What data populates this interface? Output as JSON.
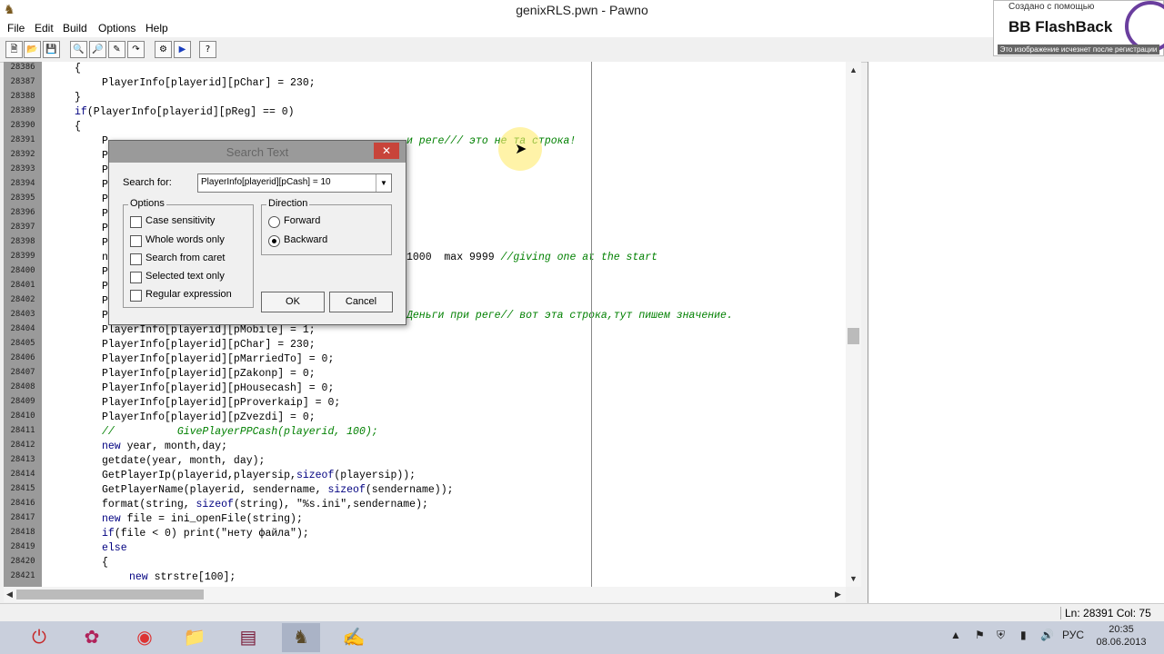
{
  "window": {
    "title": "genixRLS.pwn - Pawno"
  },
  "menu": [
    "File",
    "Edit",
    "Build",
    "Options",
    "Help"
  ],
  "badge": {
    "top": "Создано с помощью",
    "brand": "BB FlashBack",
    "strip": "Это изображение исчезнет после регистрации"
  },
  "line_numbers": [
    "28386",
    "28387",
    "28388",
    "28389",
    "28390",
    "28391",
    "28392",
    "28393",
    "28394",
    "28395",
    "28396",
    "28397",
    "28398",
    "28399",
    "28400",
    "28401",
    "28402",
    "28403",
    "28404",
    "28405",
    "28406",
    "28407",
    "28408",
    "28409",
    "28410",
    "28411",
    "28412",
    "28413",
    "28414",
    "28415",
    "28416",
    "28417",
    "28418",
    "28419",
    "28420",
    "28421"
  ],
  "code_lines": [
    {
      "indent": 1,
      "text": "{"
    },
    {
      "indent": 2,
      "text": "PlayerInfo[playerid][pChar] = 230;"
    },
    {
      "indent": 1,
      "text": "}"
    },
    {
      "indent": 1,
      "text": "if(PlayerInfo[playerid][pReg] == 0)"
    },
    {
      "indent": 1,
      "text": "{"
    },
    {
      "indent": 2,
      "text": "P"
    },
    {
      "indent": 2,
      "text": "P"
    },
    {
      "indent": 2,
      "text": "P"
    },
    {
      "indent": 2,
      "text": "P"
    },
    {
      "indent": 2,
      "text": "P"
    },
    {
      "indent": 2,
      "text": "P"
    },
    {
      "indent": 2,
      "text": "P"
    },
    {
      "indent": 2,
      "text": "P"
    },
    {
      "indent": 2,
      "text": "n"
    },
    {
      "indent": 2,
      "text": "P"
    },
    {
      "indent": 2,
      "text": "P"
    },
    {
      "indent": 2,
      "text": "P"
    },
    {
      "indent": 2,
      "text": "P"
    },
    {
      "indent": 2,
      "text": "PlayerInfo[playerid][pMobile] = 1;"
    },
    {
      "indent": 2,
      "text": "PlayerInfo[playerid][pChar] = 230;"
    },
    {
      "indent": 2,
      "text": "PlayerInfo[playerid][pMarriedTo] = 0;"
    },
    {
      "indent": 2,
      "text": "PlayerInfo[playerid][pZakonp] = 0;"
    },
    {
      "indent": 2,
      "text": "PlayerInfo[playerid][pHousecash] = 0;"
    },
    {
      "indent": 2,
      "text": "PlayerInfo[playerid][pProverkaip] = 0;"
    },
    {
      "indent": 2,
      "text": "PlayerInfo[playerid][pZvezdi] = 0;"
    },
    {
      "indent": 2,
      "text": "//          GivePlayerPPCash(playerid, 100);",
      "comment": true
    },
    {
      "indent": 2,
      "text": "new year, month,day;"
    },
    {
      "indent": 2,
      "text": "getdate(year, month, day);"
    },
    {
      "indent": 2,
      "text": "GetPlayerIp(playerid,playersip,sizeof(playersip));"
    },
    {
      "indent": 2,
      "text": "GetPlayerName(playerid, sendername, sizeof(sendername));"
    },
    {
      "indent": 2,
      "text": "format(string, sizeof(string), \"%s.ini\",sendername);"
    },
    {
      "indent": 2,
      "text": "new file = ini_openFile(string);"
    },
    {
      "indent": 2,
      "text": "if(file < 0) print(\"нету файла\");"
    },
    {
      "indent": 2,
      "text": "else"
    },
    {
      "indent": 2,
      "text": "{"
    },
    {
      "indent": 3,
      "text": "new strstre[100];"
    }
  ],
  "partial_lines": [
    {
      "row": 5,
      "text": "и реге/// это не та строка!",
      "comment": true
    },
    {
      "row": 13,
      "text": "1000  max 9999 //giving one at the start",
      "comment": false
    },
    {
      "row": 17,
      "text": "Деньги при реге// вот эта строка,тут пишем значение.",
      "comment": true
    }
  ],
  "dialog": {
    "title": "Search Text",
    "search_label": "Search for:",
    "search_value": "PlayerInfo[playerid][pCash] = 10",
    "options_title": "Options",
    "options": [
      {
        "label": "Case sensitivity",
        "checked": false
      },
      {
        "label": "Whole words only",
        "checked": false
      },
      {
        "label": "Search from caret",
        "checked": false
      },
      {
        "label": "Selected text only",
        "checked": false
      },
      {
        "label": "Regular expression",
        "checked": false
      }
    ],
    "direction_title": "Direction",
    "directions": [
      {
        "label": "Forward",
        "selected": false
      },
      {
        "label": "Backward",
        "selected": true
      }
    ],
    "ok_label": "OK",
    "cancel_label": "Cancel"
  },
  "status": {
    "position": "Ln: 28391  Col: 75"
  },
  "tray": {
    "lang": "РУС",
    "time": "20:35",
    "date": "08.06.2013"
  },
  "colors": {
    "gutter": "#9a9a9a",
    "comment": "#008000",
    "keyword": "#000080",
    "close": "#c8443a"
  }
}
